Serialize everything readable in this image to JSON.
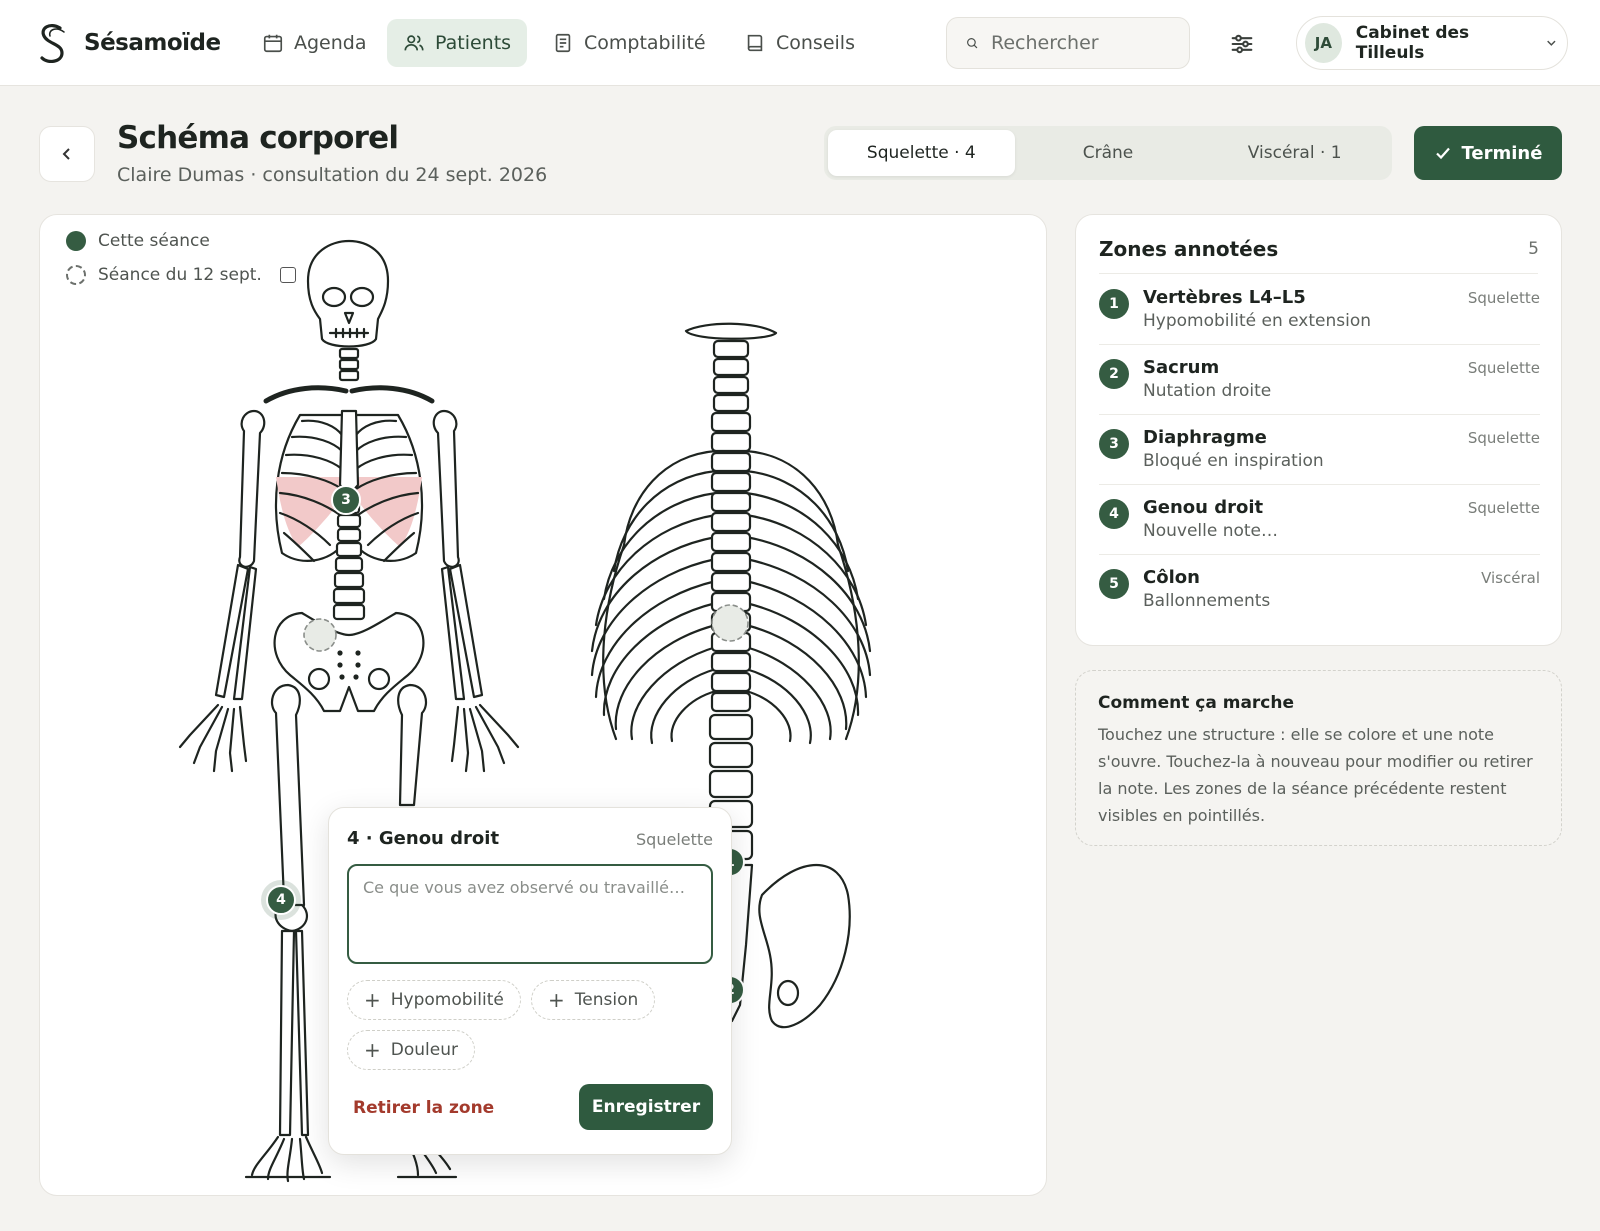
{
  "app": {
    "name": "Sésamoïde"
  },
  "nav": [
    {
      "label": "Agenda",
      "icon": "calendar-icon",
      "active": false
    },
    {
      "label": "Patients",
      "icon": "users-icon",
      "active": true
    },
    {
      "label": "Comptabilité",
      "icon": "receipt-icon",
      "active": false
    },
    {
      "label": "Conseils",
      "icon": "book-icon",
      "active": false
    }
  ],
  "search": {
    "placeholder": "Rechercher"
  },
  "account": {
    "initials": "JA",
    "name": "Cabinet des Tilleuls"
  },
  "header": {
    "title": "Schéma corporel",
    "subtitle": "Claire Dumas · consultation du 24 sept. 2026"
  },
  "views": [
    {
      "label": "Squelette · 4",
      "active": true
    },
    {
      "label": "Crâne",
      "active": false
    },
    {
      "label": "Viscéral · 1",
      "active": false
    }
  ],
  "done_button": {
    "label": "Terminé"
  },
  "legend": {
    "current": "Cette séance",
    "previous": "Séance du 12 sept."
  },
  "markers": [
    "1",
    "2",
    "3",
    "4"
  ],
  "popover": {
    "title": "4 · Genou droit",
    "category": "Squelette",
    "placeholder": "Ce que vous avez observé ou travaillé…",
    "chips": [
      "Hypomobilité",
      "Tension",
      "Douleur"
    ],
    "remove_label": "Retirer la zone",
    "save_label": "Enregistrer"
  },
  "zones": {
    "title": "Zones annotées",
    "count": "5",
    "items": [
      {
        "num": "1",
        "name": "Vertèbres L4–L5",
        "desc": "Hypomobilité en extension",
        "category": "Squelette"
      },
      {
        "num": "2",
        "name": "Sacrum",
        "desc": "Nutation droite",
        "category": "Squelette"
      },
      {
        "num": "3",
        "name": "Diaphragme",
        "desc": "Bloqué en inspiration",
        "category": "Squelette"
      },
      {
        "num": "4",
        "name": "Genou droit",
        "desc": "Nouvelle note…",
        "category": "Squelette"
      },
      {
        "num": "5",
        "name": "Côlon",
        "desc": "Ballonnements",
        "category": "Viscéral"
      }
    ]
  },
  "help": {
    "title": "Comment ça marche",
    "body": "Touchez une structure : elle se colore et une note s'ouvre. Touchez-la à nouveau pour modifier ou retirer la note. Les zones de la séance précédente restent visibles en pointillés."
  },
  "colors": {
    "accent": "#2f5a3f",
    "accent_light": "#e5eee6",
    "danger": "#a33a2c",
    "highlight": "#f2c9c9"
  }
}
